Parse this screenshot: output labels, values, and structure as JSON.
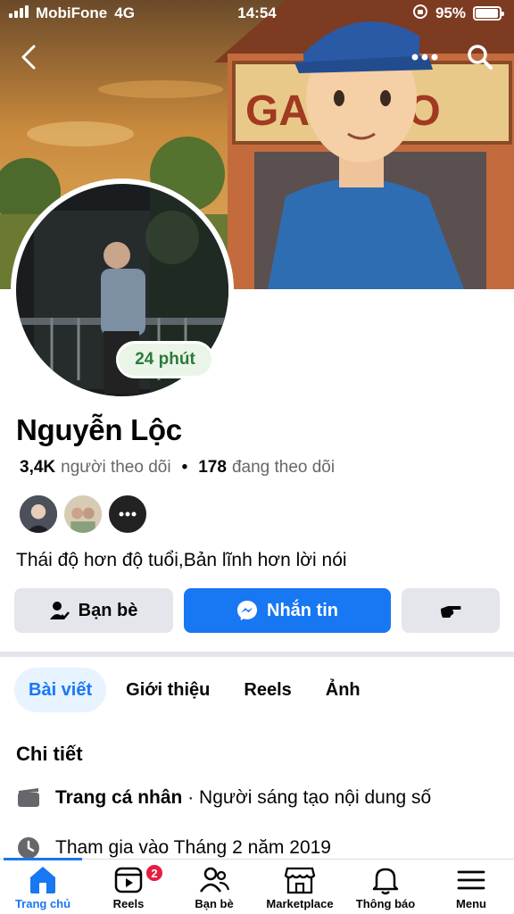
{
  "status_bar": {
    "carrier": "MobiFone",
    "network": "4G",
    "time": "14:54",
    "battery": "95%",
    "battery_level": 0.95
  },
  "profile": {
    "name": "Nguyễn Lộc",
    "story_time": "24 phút",
    "followers_count": "3,4K",
    "followers_label": "người theo dõi",
    "following_count": "178",
    "following_label": "đang theo dõi",
    "bio": "Thái độ hơn độ tuổi,Bản lĩnh hơn lời nói"
  },
  "cover": {
    "sign_text": "GARA   TO"
  },
  "actions": {
    "friends_label": "Bạn bè",
    "message_label": "Nhắn tin"
  },
  "tabs": [
    {
      "label": "Bài viết",
      "active": true
    },
    {
      "label": "Giới thiệu",
      "active": false
    },
    {
      "label": "Reels",
      "active": false
    },
    {
      "label": "Ảnh",
      "active": false
    }
  ],
  "details": {
    "title": "Chi tiết",
    "page_type_bold": "Trang cá nhân",
    "page_type_rest": " · Người sáng tạo nội dung số",
    "joined": "Tham gia vào Tháng 2 năm 2019"
  },
  "bottom_nav": [
    {
      "label": "Trang chủ",
      "icon": "home-icon",
      "active": true
    },
    {
      "label": "Reels",
      "icon": "reels-icon",
      "badge": "2"
    },
    {
      "label": "Bạn bè",
      "icon": "friends-icon"
    },
    {
      "label": "Marketplace",
      "icon": "marketplace-icon"
    },
    {
      "label": "Thông báo",
      "icon": "bell-icon"
    },
    {
      "label": "Menu",
      "icon": "menu-icon"
    }
  ],
  "colors": {
    "accent": "#1877f2",
    "story_green": "#2b7a3d",
    "badge_red": "#e41e3f"
  }
}
